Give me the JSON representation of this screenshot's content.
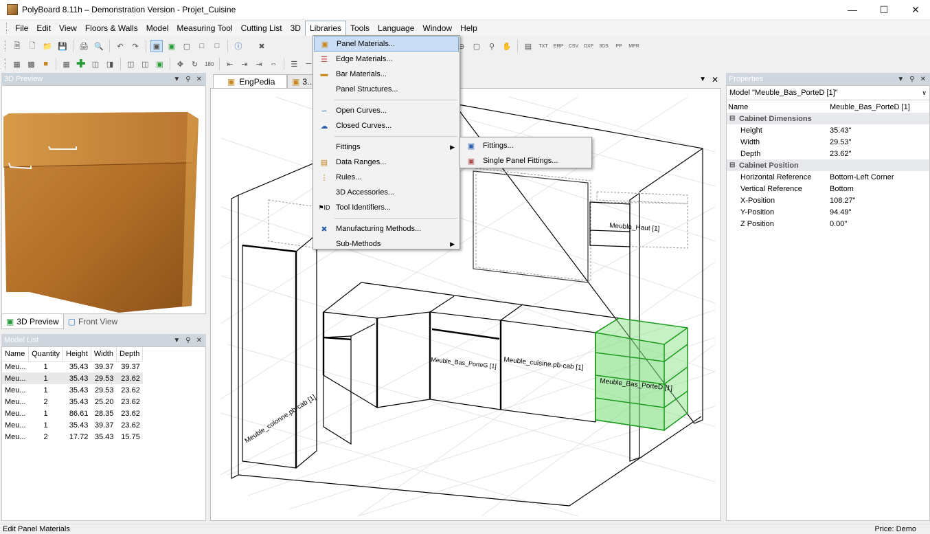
{
  "window": {
    "title": "PolyBoard 8.11h – Demonstration Version - Projet_Cuisine"
  },
  "menubar": [
    "File",
    "Edit",
    "View",
    "Floors & Walls",
    "Model",
    "Measuring Tool",
    "Cutting List",
    "3D",
    "Libraries",
    "Tools",
    "Language",
    "Window",
    "Help"
  ],
  "preview_panel": {
    "title": "3D Preview",
    "tabs": [
      "3D Preview",
      "Front View"
    ]
  },
  "model_list": {
    "title": "Model List",
    "columns": [
      "Name",
      "Quantity",
      "Height",
      "Width",
      "Depth"
    ],
    "rows": [
      [
        "Meu...",
        "1",
        "35.43",
        "39.37",
        "39.37"
      ],
      [
        "Meu...",
        "1",
        "35.43",
        "29.53",
        "23.62"
      ],
      [
        "Meu...",
        "1",
        "35.43",
        "29.53",
        "23.62"
      ],
      [
        "Meu...",
        "2",
        "35.43",
        "25.20",
        "23.62"
      ],
      [
        "Meu...",
        "1",
        "86.61",
        "28.35",
        "23.62"
      ],
      [
        "Meu...",
        "1",
        "35.43",
        "39.37",
        "23.62"
      ],
      [
        "Meu...",
        "2",
        "17.72",
        "35.43",
        "15.75"
      ]
    ]
  },
  "doc_tabs": [
    "EngPedia",
    "3..."
  ],
  "scene_labels": {
    "haut": "Meuble_Haut [1]",
    "porteg": "Meuble_Bas_PorteG [1]",
    "cuisine": "Meuble_cuisine.pb-cab [1]",
    "ported": "Meuble_Bas_PorteD [1]",
    "colonne": "Meuble_colonne.pb-cab [1]"
  },
  "properties": {
    "title": "Properties",
    "model_select": "Model \"Meuble_Bas_PorteD [1]\"",
    "name_label": "Name",
    "name_value": "Meuble_Bas_PorteD [1]",
    "cat1": "Cabinet Dimensions",
    "height_label": "Height",
    "height_value": "35.43\"",
    "width_label": "Width",
    "width_value": "29.53\"",
    "depth_label": "Depth",
    "depth_value": "23.62\"",
    "cat2": "Cabinet Position",
    "href_label": "Horizontal Reference",
    "href_value": "Bottom-Left Corner",
    "vref_label": "Vertical Reference",
    "vref_value": "Bottom",
    "x_label": "X-Position",
    "x_value": "108.27\"",
    "y_label": "Y-Position",
    "y_value": "94.49\"",
    "z_label": "Z Position",
    "z_value": "0.00\""
  },
  "libraries_menu": [
    "Panel Materials...",
    "Edge Materials...",
    "Bar Materials...",
    "Panel Structures...",
    "Open Curves...",
    "Closed Curves...",
    "Fittings",
    "Data Ranges...",
    "Rules...",
    "3D Accessories...",
    "Tool Identifiers...",
    "Manufacturing Methods...",
    "Sub-Methods"
  ],
  "fittings_submenu": [
    "Fittings...",
    "Single Panel Fittings..."
  ],
  "status": {
    "left": "Edit Panel Materials",
    "right": "Price: Demo"
  }
}
